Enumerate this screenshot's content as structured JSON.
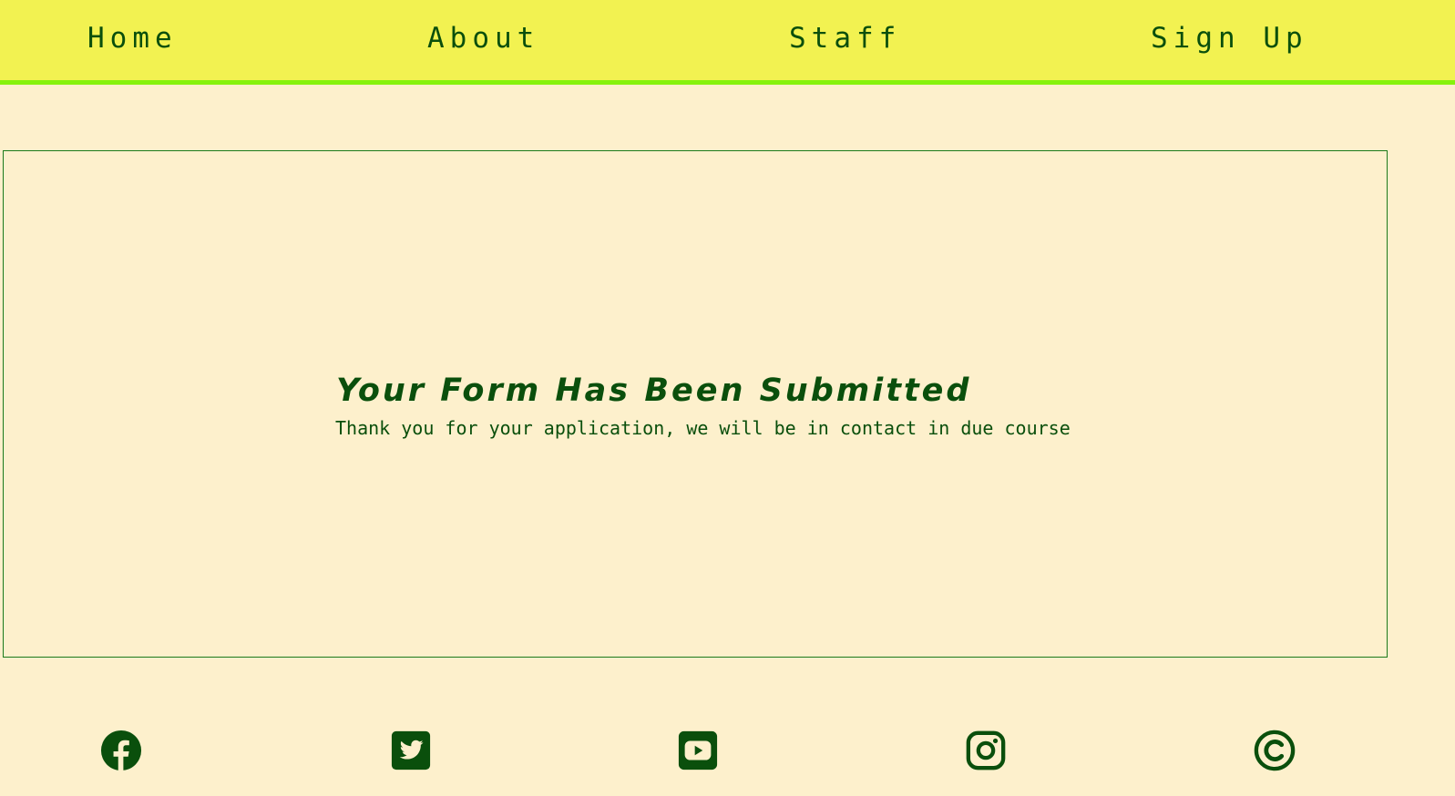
{
  "nav": {
    "items": [
      {
        "label": "Home"
      },
      {
        "label": "About"
      },
      {
        "label": "Staff"
      },
      {
        "label": "Sign Up"
      }
    ]
  },
  "main": {
    "heading": "Your Form Has Been Submitted",
    "message": "Thank you for your application, we will be in contact in due course"
  },
  "footer": {
    "icons": [
      "facebook-icon",
      "twitter-icon",
      "youtube-icon",
      "instagram-icon",
      "copyright-icon"
    ]
  },
  "colors": {
    "background": "#fdf0cc",
    "navbar": "#f2f251",
    "navbar_border": "#86f20d",
    "text": "#0a4f0c"
  }
}
